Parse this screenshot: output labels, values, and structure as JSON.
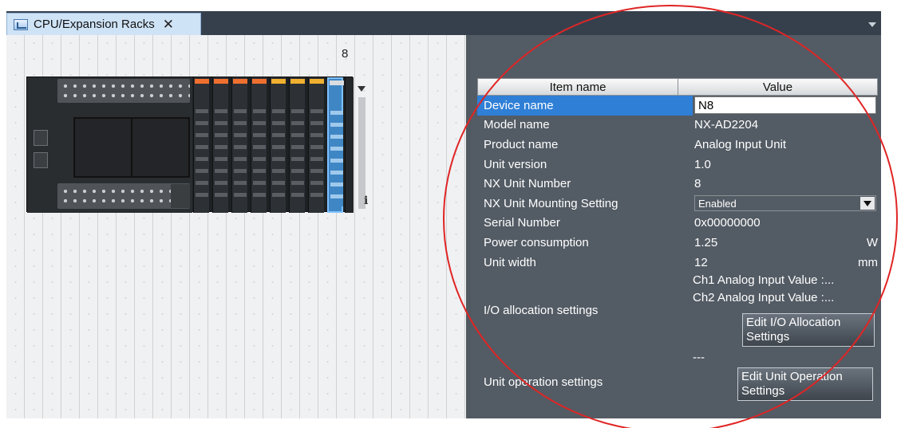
{
  "tab": {
    "label": "CPU/Expansion Racks",
    "close": "✕",
    "icon": "rack-icon"
  },
  "canvas": {
    "slot_number": "8",
    "info_glyph": "i",
    "unit_caps": [
      "#f07030",
      "#f07030",
      "#f07030",
      "#f07030",
      "#f0b030",
      "#f0b030",
      "#f0b030",
      "#d9dde2"
    ]
  },
  "properties": {
    "headers": {
      "name": "Item name",
      "value": "Value"
    },
    "device_name": {
      "label": "Device name",
      "value": "N8"
    },
    "model_name": {
      "label": "Model name",
      "value": "NX-AD2204"
    },
    "product_name": {
      "label": "Product name",
      "value": "Analog Input Unit"
    },
    "unit_version": {
      "label": "Unit version",
      "value": "1.0"
    },
    "nx_unit_number": {
      "label": "NX Unit Number",
      "value": "8"
    },
    "mounting": {
      "label": "NX Unit Mounting Setting",
      "value": "Enabled"
    },
    "serial_number": {
      "label": "Serial Number",
      "value": "0x00000000"
    },
    "power": {
      "label": "Power consumption",
      "value": "1.25",
      "unit": "W"
    },
    "width": {
      "label": "Unit width",
      "value": "12",
      "unit": "mm"
    },
    "io_allocation": {
      "label": "I/O allocation settings",
      "line1": "Ch1 Analog Input Value :...",
      "line2": "Ch2 Analog Input Value :...",
      "button": "Edit I/O Allocation Settings"
    },
    "unit_operation": {
      "label": "Unit operation settings",
      "value": "---",
      "button": "Edit Unit Operation Settings"
    }
  },
  "colors": {
    "highlight": "#2f7fd6",
    "annotation_circle": "#e02525",
    "panel": "#535b64"
  }
}
